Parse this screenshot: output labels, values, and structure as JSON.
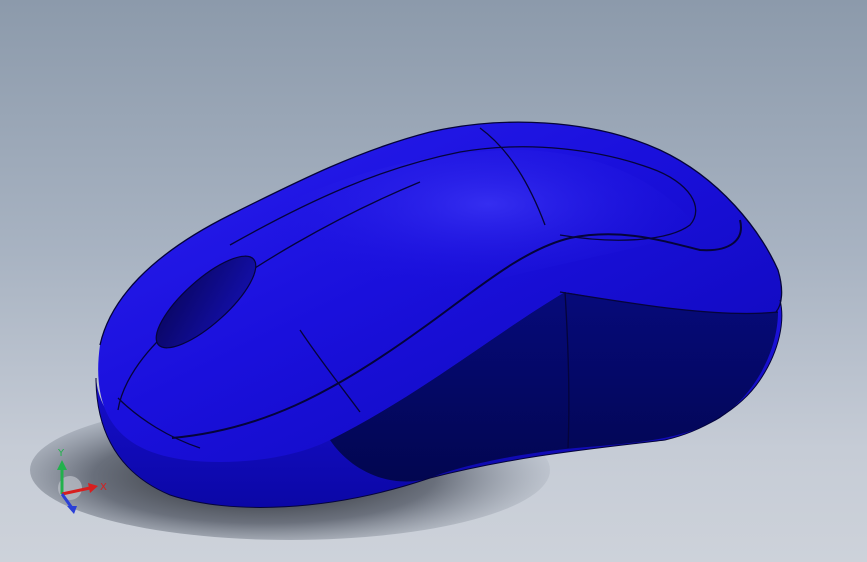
{
  "viewport": {
    "background_top": "#8c9aab",
    "background_bottom": "#cdd2da"
  },
  "model": {
    "type": "computer mouse",
    "body_color": "#1a0fd6",
    "side_shadow_color": "#030860",
    "edge_color": "#05043a"
  },
  "triad": {
    "x_label": "X",
    "y_label": "Y",
    "x_color": "#d81e1e",
    "y_color": "#22b14c",
    "z_color": "#2a3fd6"
  }
}
